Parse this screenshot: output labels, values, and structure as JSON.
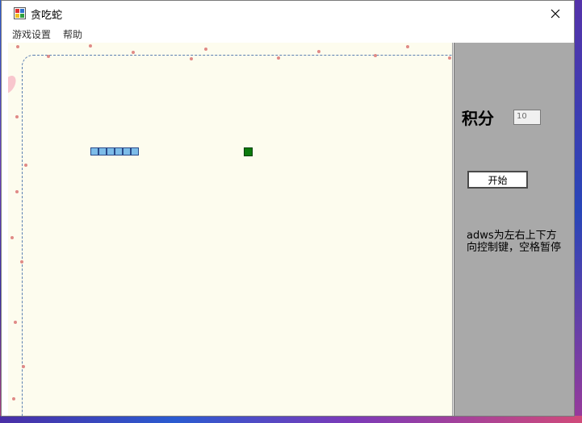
{
  "window": {
    "title": "贪吃蛇"
  },
  "menu": {
    "items": [
      "游戏设置",
      "帮助"
    ]
  },
  "game": {
    "snake_length": 6,
    "food": "green-square"
  },
  "panel": {
    "score_label": "积分",
    "score_value": "10",
    "start_label": "开始",
    "help_text": "adws为左右上下方向控制键，空格暂停"
  },
  "colors": {
    "board_background": "#fdfcee",
    "side_panel": "#a9a9a9",
    "snake": "#7dbce8",
    "food": "#0c7a0c"
  },
  "icons": {
    "app": "app-window-icon",
    "close": "close-icon"
  }
}
